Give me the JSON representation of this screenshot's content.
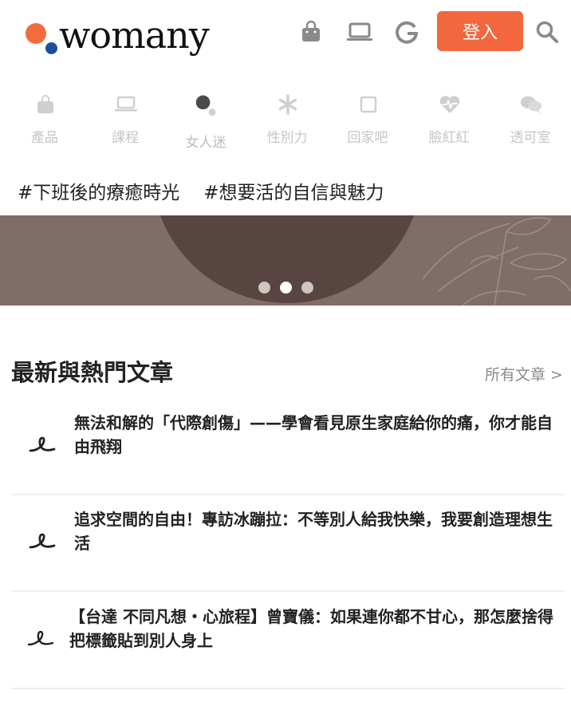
{
  "header": {
    "logo_text": "womany",
    "login_label": "登入",
    "icons": [
      "shopping-bag-icon",
      "laptop-icon",
      "google-icon",
      "search-icon"
    ],
    "accent_color": "#f2673d"
  },
  "categories": [
    {
      "label": "產品",
      "icon": "shopping-bag-icon"
    },
    {
      "label": "課程",
      "icon": "laptop-icon"
    },
    {
      "label": "女人迷",
      "icon": "womany-dots-icon",
      "active": true
    },
    {
      "label": "性別力",
      "icon": "asterisk-icon"
    },
    {
      "label": "回家吧",
      "icon": "square-icon"
    },
    {
      "label": "臉紅紅",
      "icon": "heartbeat-icon"
    },
    {
      "label": "透可室",
      "icon": "chat-bubbles-icon"
    }
  ],
  "hashtags": [
    "#下班後的療癒時光",
    "#想要活的自信與魅力"
  ],
  "banner": {
    "dots": 3,
    "active_dot": 1,
    "background_color": "#806d68"
  },
  "section": {
    "title": "最新與熱門文章",
    "more_link": "所有文章 >"
  },
  "articles": [
    {
      "title": "無法和解的「代際創傷」——學會看見原生家庭給你的痛，你才能自由飛翔"
    },
    {
      "title": "追求空間的自由！專訪冰蹦拉：不等別人給我快樂，我要創造理想生活"
    },
    {
      "title": "【台達 不同凡想・心旅程】曾寶儀：如果連你都不甘心，那怎麼捨得把標籤貼到別人身上"
    }
  ]
}
